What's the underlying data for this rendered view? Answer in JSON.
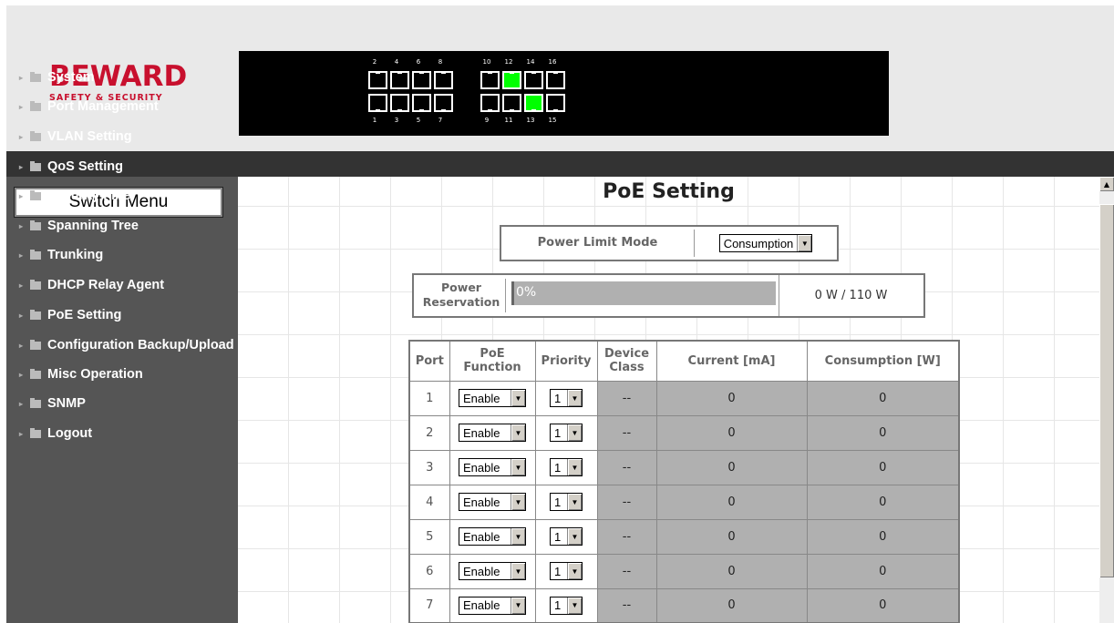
{
  "brand": {
    "name": "BEWARD",
    "tagline": "SAFETY & SECURITY"
  },
  "panel": {
    "top_ports": [
      "2",
      "4",
      "6",
      "8",
      "10",
      "12",
      "14",
      "16"
    ],
    "bottom_ports": [
      "1",
      "3",
      "5",
      "7",
      "9",
      "11",
      "13",
      "15"
    ],
    "linked_ports": [
      "12",
      "13"
    ]
  },
  "sidebar": {
    "title": "Switch Menu",
    "items": [
      {
        "label": "System"
      },
      {
        "label": "Port Management"
      },
      {
        "label": "VLAN Setting"
      },
      {
        "label": "QoS Setting"
      },
      {
        "label": "Security Filter"
      },
      {
        "label": "Spanning Tree"
      },
      {
        "label": "Trunking"
      },
      {
        "label": "DHCP Relay Agent"
      },
      {
        "label": "PoE Setting"
      },
      {
        "label": "Configuration Backup/Upload"
      },
      {
        "label": "Misc Operation"
      },
      {
        "label": "SNMP"
      },
      {
        "label": "Logout"
      }
    ]
  },
  "main": {
    "title": "PoE Setting",
    "power_limit_mode": {
      "label": "Power Limit Mode",
      "value": "Consumption"
    },
    "power_reservation": {
      "label_line1": "Power",
      "label_line2": "Reservation",
      "percent_text": "0%",
      "percent": 0,
      "value": "0 W / 110 W"
    },
    "table": {
      "headers": {
        "port": "Port",
        "poe_function_1": "PoE",
        "poe_function_2": "Function",
        "priority": "Priority",
        "device_class_1": "Device",
        "device_class_2": "Class",
        "current": "Current [mA]",
        "consumption": "Consumption [W]"
      },
      "rows": [
        {
          "port": "1",
          "function": "Enable",
          "priority": "1",
          "device_class": "--",
          "current": "0",
          "consumption": "0"
        },
        {
          "port": "2",
          "function": "Enable",
          "priority": "1",
          "device_class": "--",
          "current": "0",
          "consumption": "0"
        },
        {
          "port": "3",
          "function": "Enable",
          "priority": "1",
          "device_class": "--",
          "current": "0",
          "consumption": "0"
        },
        {
          "port": "4",
          "function": "Enable",
          "priority": "1",
          "device_class": "--",
          "current": "0",
          "consumption": "0"
        },
        {
          "port": "5",
          "function": "Enable",
          "priority": "1",
          "device_class": "--",
          "current": "0",
          "consumption": "0"
        },
        {
          "port": "6",
          "function": "Enable",
          "priority": "1",
          "device_class": "--",
          "current": "0",
          "consumption": "0"
        },
        {
          "port": "7",
          "function": "Enable",
          "priority": "1",
          "device_class": "--",
          "current": "0",
          "consumption": "0"
        }
      ]
    }
  },
  "colors": {
    "brand": "#c8102e",
    "link": "#00ff00",
    "sidebar": "#555555",
    "grey_cell": "#b0b0b0"
  }
}
